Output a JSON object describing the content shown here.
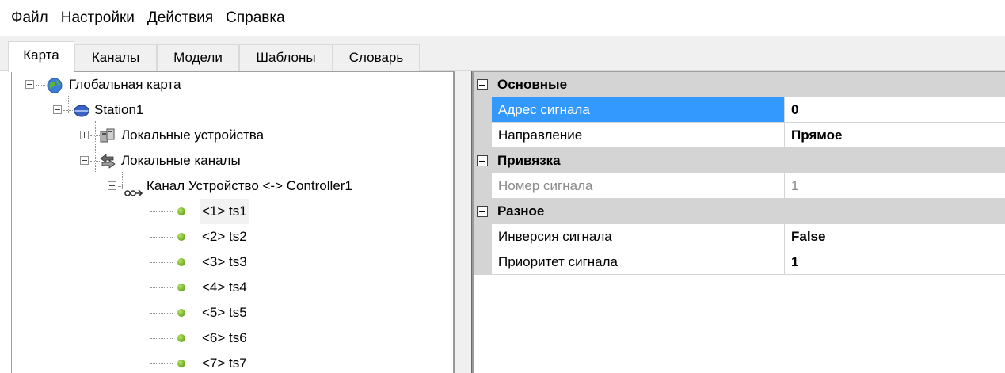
{
  "menu": [
    "Файл",
    "Настройки",
    "Действия",
    "Справка"
  ],
  "tabs": [
    "Карта",
    "Каналы",
    "Модели",
    "Шаблоны",
    "Словарь"
  ],
  "tree": {
    "global_map": "Глобальная карта",
    "station": "Station1",
    "local_devices": "Локальные устройства",
    "local_channels": "Локальные каналы",
    "channel": "Канал Устройство <-> Controller1",
    "signals": [
      "<1> ts1",
      "<2> ts2",
      "<3> ts3",
      "<4> ts4",
      "<5> ts5",
      "<6> ts6",
      "<7> ts7"
    ]
  },
  "properties": {
    "cat_main": "Основные",
    "signal_address_label": "Адрес сигнала",
    "signal_address_value": "0",
    "direction_label": "Направление",
    "direction_value": "Прямое",
    "cat_binding": "Привязка",
    "signal_number_label": "Номер сигнала",
    "signal_number_value": "1",
    "cat_misc": "Разное",
    "inversion_label": "Инверсия сигнала",
    "inversion_value": "False",
    "priority_label": "Приоритет сигнала",
    "priority_value": "1"
  },
  "colors": {
    "selection": "#3399ff",
    "category_bg": "#d4d4d4",
    "signal_dot": "#6cab20"
  }
}
